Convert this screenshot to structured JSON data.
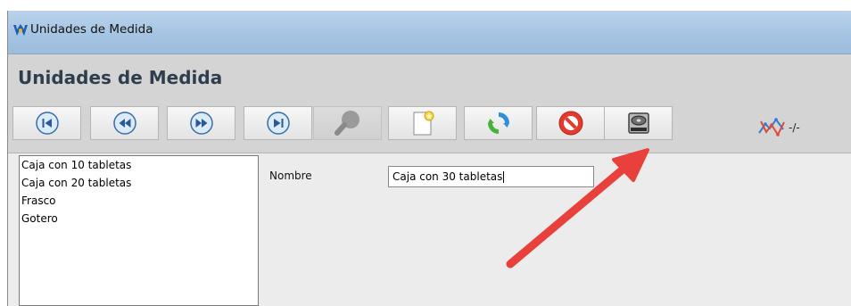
{
  "window": {
    "title": "Unidades de Medida",
    "app_icon": "app-logo-icon"
  },
  "header": {
    "title": "Unidades de Medida"
  },
  "toolbar": {
    "buttons": [
      {
        "name": "first-record-button",
        "icon": "skip-to-first-icon",
        "enabled": true
      },
      {
        "name": "previous-record-button",
        "icon": "rewind-icon",
        "enabled": true
      },
      {
        "name": "next-record-button",
        "icon": "fast-forward-icon",
        "enabled": true
      },
      {
        "name": "last-record-button",
        "icon": "skip-to-last-icon",
        "enabled": true
      },
      {
        "name": "search-button",
        "icon": "magnifier-icon",
        "enabled": false
      },
      {
        "name": "new-record-button",
        "icon": "new-document-icon",
        "enabled": true
      },
      {
        "name": "refresh-button",
        "icon": "refresh-icon",
        "enabled": true
      },
      {
        "name": "delete-button",
        "icon": "no-entry-icon",
        "enabled": true
      },
      {
        "name": "save-button",
        "icon": "hard-drive-icon",
        "enabled": true
      }
    ],
    "record_counter": {
      "icon": "chart-line-icon",
      "text": "-/-"
    }
  },
  "list": {
    "items": [
      "Caja con 10 tabletas",
      "Caja con 20 tabletas",
      "Frasco",
      "Gotero"
    ]
  },
  "form": {
    "nombre_label": "Nombre",
    "nombre_value": "Caja con 30 tabletas"
  },
  "colors": {
    "annotation_arrow": "#e8413c",
    "titlebar": "#a9c7e4",
    "header_title": "#2f3e4e"
  }
}
